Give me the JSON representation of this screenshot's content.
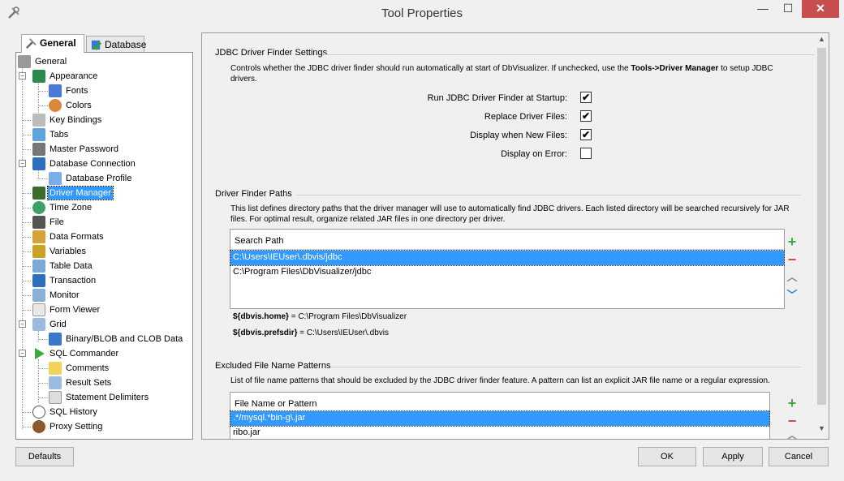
{
  "window": {
    "title": "Tool Properties",
    "minimize": "—",
    "maximize": "☐",
    "close": "✕"
  },
  "tabs": [
    {
      "label": "General"
    },
    {
      "label": "Database"
    }
  ],
  "tree": {
    "general": "General",
    "appearance": "Appearance",
    "fonts": "Fonts",
    "colors": "Colors",
    "key_bindings": "Key Bindings",
    "tabs": "Tabs",
    "master_password": "Master Password",
    "database_connection": "Database Connection",
    "database_profile": "Database Profile",
    "driver_manager": "Driver Manager",
    "time_zone": "Time Zone",
    "file": "File",
    "data_formats": "Data Formats",
    "variables": "Variables",
    "table_data": "Table Data",
    "transaction": "Transaction",
    "monitor": "Monitor",
    "form_viewer": "Form Viewer",
    "grid": "Grid",
    "binary_blob": "Binary/BLOB and CLOB Data",
    "sql_commander": "SQL Commander",
    "comments": "Comments",
    "result_sets": "Result Sets",
    "statement_delimiters": "Statement Delimiters",
    "sql_history": "SQL History",
    "proxy_setting": "Proxy Setting"
  },
  "finder": {
    "heading": "JDBC Driver Finder Settings",
    "desc_pre": "Controls whether the JDBC driver finder should run automatically at start of DbVisualizer. If unchecked, use the ",
    "desc_bold": "Tools->Driver Manager",
    "desc_post": " to setup JDBC drivers.",
    "run_label": "Run JDBC Driver Finder at Startup:",
    "run_checked": "✔",
    "replace_label": "Replace Driver Files:",
    "replace_checked": "✔",
    "display_new_label": "Display when New Files:",
    "display_new_checked": "✔",
    "display_error_label": "Display on Error:",
    "display_error_checked": ""
  },
  "paths": {
    "heading": "Driver Finder Paths",
    "desc": "This list defines directory paths that the driver manager will use to automatically find JDBC drivers. Each listed directory will be searched recursively for JAR files. For optimal result, organize related JAR files in one directory per driver.",
    "column": "Search Path",
    "rows": [
      "C:\\Users\\IEUser\\.dbvis/jdbc",
      "C:\\Program Files\\DbVisualizer/jdbc"
    ],
    "var1_name": "${dbvis.home}",
    "var1_value": " = C:\\Program Files\\DbVisualizer",
    "var2_name": "${dbvis.prefsdir}",
    "var2_value": " = C:\\Users\\IEUser\\.dbvis"
  },
  "excluded": {
    "heading": "Excluded File Name Patterns",
    "desc": "List of file name patterns that should be excluded by the JDBC driver finder feature. A pattern can list an explicit JAR file name or a regular expression.",
    "column": "File Name or Pattern",
    "rows": [
      ".*/mysql.*bin-g\\.jar",
      "ribo.jar"
    ]
  },
  "side_buttons": {
    "add": "+",
    "remove": "−",
    "up": "︿",
    "down": "﹀"
  },
  "buttons": {
    "defaults": "Defaults",
    "ok": "OK",
    "apply": "Apply",
    "cancel": "Cancel"
  },
  "colors": {
    "selection": "#3399ff",
    "add": "#3caa3c",
    "remove": "#d9463e",
    "arrow": "#2a7fd4"
  }
}
